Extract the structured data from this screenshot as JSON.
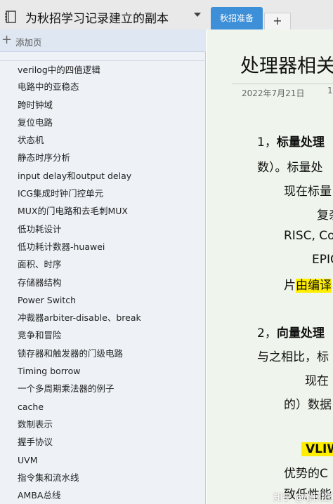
{
  "titlebar": {
    "notebook_title": "为秋招学习记录建立的副本",
    "active_tab": "秋招准备",
    "add_tab": "+"
  },
  "sidebar": {
    "add_page_label": "添加页",
    "pages": [
      "verilog中的四值逻辑",
      "电路中的亚稳态",
      "跨时钟域",
      "复位电路",
      "状态机",
      "静态时序分析",
      "input delay和output delay",
      "ICG集成时钟门控单元",
      "MUX的门电路和去毛刺MUX",
      "低功耗设计",
      "低功耗计数器-huawei",
      "面积、时序",
      "存储器结构",
      "Power Switch",
      "冲裁器arbiter-disable、break",
      "竞争和冒险",
      "锁存器和触发器的门级电路",
      "Timing borrow",
      "一个多周期乘法器的例子",
      "cache",
      "数制表示",
      "握手协议",
      "UVM",
      "指令集和流水线",
      "AMBA总线"
    ]
  },
  "page": {
    "title": "处理器相关",
    "date": "2022年7月21日",
    "time": "1",
    "lines": {
      "l1_prefix": "1，",
      "l1_bold": "标量处理",
      "l2": "数）。标量处",
      "l3": "现在标量",
      "l4": "复杂",
      "l5": "RISC, Co",
      "l6": "EPIC",
      "l7_prefix": "片",
      "l7_hl": "由编译",
      "l8_prefix": "2，",
      "l8_bold": "向量处理",
      "l9": "与之相比，标",
      "l10": "现在",
      "l11": "的）数据",
      "l12_hl": "VLIW",
      "l13": "优势的C",
      "l14": "致低性能"
    },
    "watermark": "知乎 @lg秋招程"
  }
}
